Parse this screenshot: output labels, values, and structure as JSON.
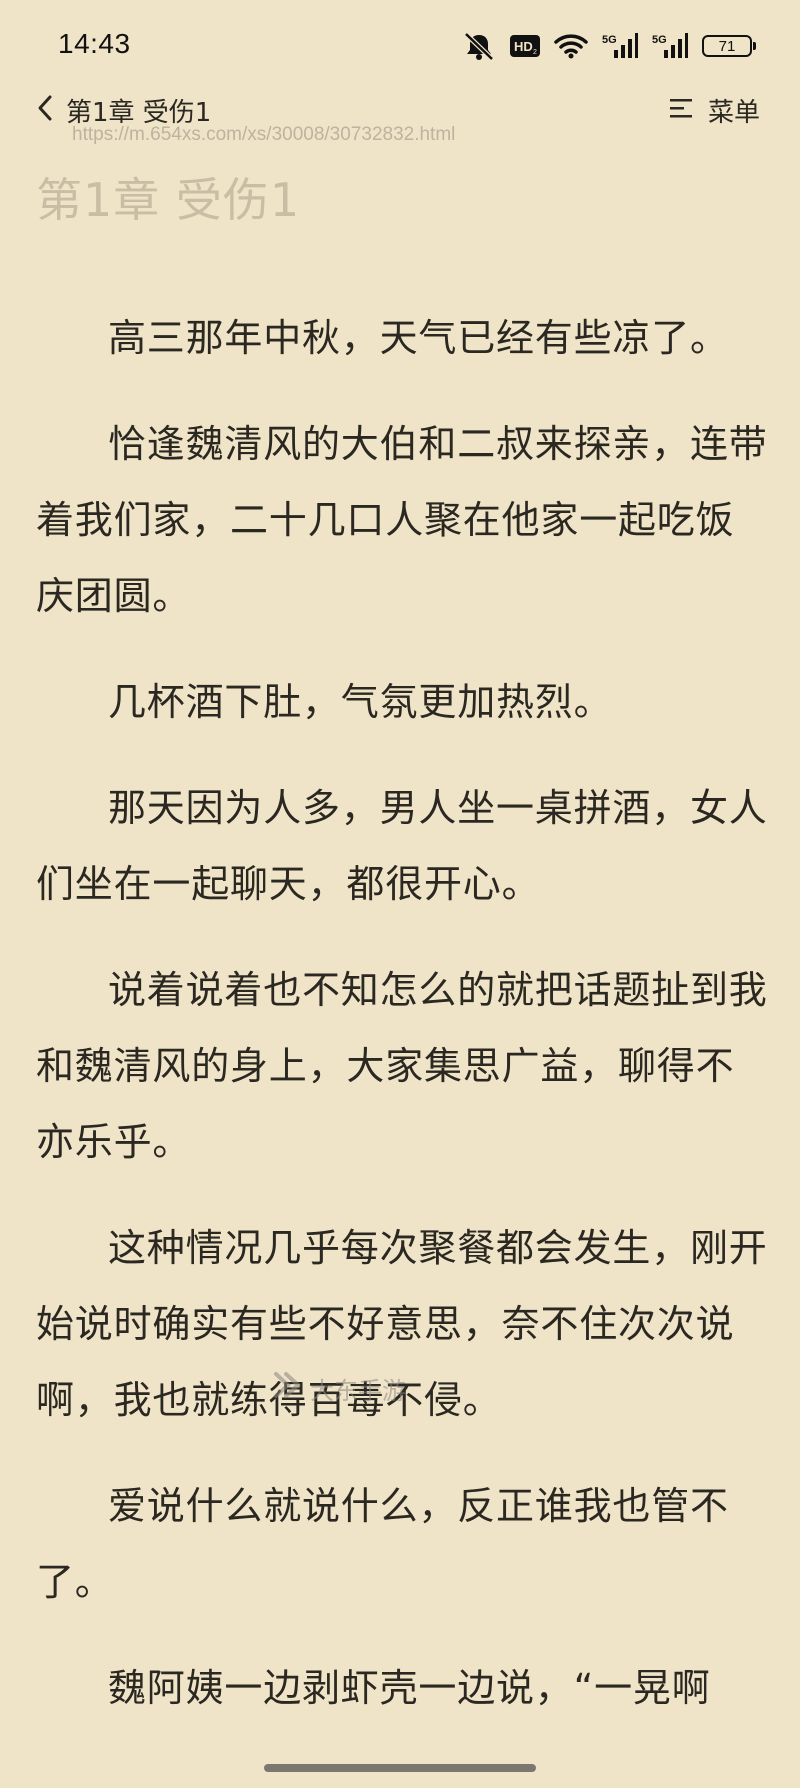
{
  "status_bar": {
    "time": "14:43",
    "battery_level": "71",
    "icons": [
      "mute-icon",
      "hd-icon",
      "wifi-icon",
      "signal-5g-icon",
      "signal-5g-icon",
      "battery-icon"
    ]
  },
  "nav": {
    "back_title": "第1章 受伤1",
    "menu_label": "菜单"
  },
  "url": "https://m.654xs.com/xs/30008/30732832.html",
  "chapter_heading": "第1章 受伤1",
  "paragraphs": [
    "高三那年中秋，天气已经有些凉了。",
    "恰逢魏清风的大伯和二叔来探亲，连带着我们家，二十几口人聚在他家一起吃饭庆团圆。",
    "几杯酒下肚，气氛更加热烈。",
    "那天因为人多，男人坐一桌拼酒，女人们坐在一起聊天，都很开心。",
    "说着说着也不知怎么的就把话题扯到我和魏清风的身上，大家集思广益，聊得不亦乐乎。",
    "这种情况几乎每次聚餐都会发生，刚开始说时确实有些不好意思，奈不住次次说啊，我也就练得百毒不侵。",
    "爱说什么就说什么，反正谁我也管不了。",
    "魏阿姨一边剥虾壳一边说，“一晃啊"
  ],
  "watermark": "大东手游"
}
